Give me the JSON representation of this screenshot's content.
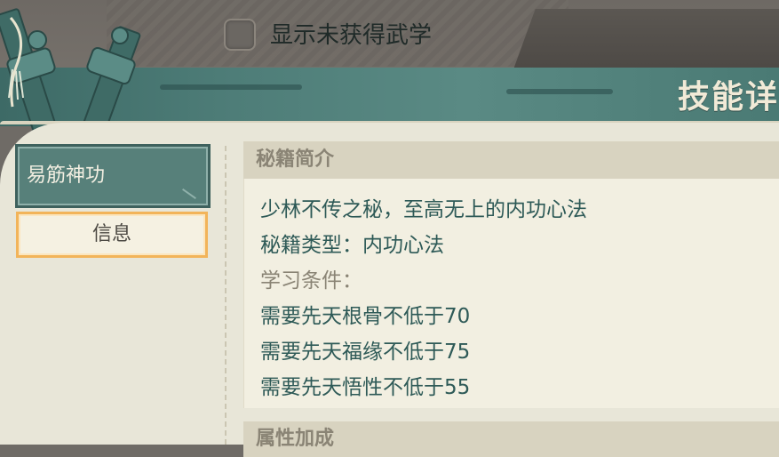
{
  "filter": {
    "checkbox_label": "显示未获得武学",
    "checked": false
  },
  "banner": {
    "title": "技能详"
  },
  "nav": {
    "skill_name": "易筋神功",
    "info_tab": "信息"
  },
  "details": {
    "header": "秘籍简介",
    "lines": [
      "少林不传之秘，至高无上的内功心法",
      "秘籍类型：内功心法",
      "学习条件：",
      "需要先天根骨不低于70",
      "需要先天福缘不低于75",
      "需要先天悟性不低于55"
    ]
  },
  "attributes": {
    "header": "属性加成"
  },
  "colors": {
    "teal": "#4e7d78",
    "parchment": "#e8e6d8",
    "highlight_border": "#f2b45a",
    "text_teal": "#2e5a57",
    "text_muted": "#8a8475"
  },
  "icons": {
    "emblem": "crossed-swords-emblem-icon"
  }
}
